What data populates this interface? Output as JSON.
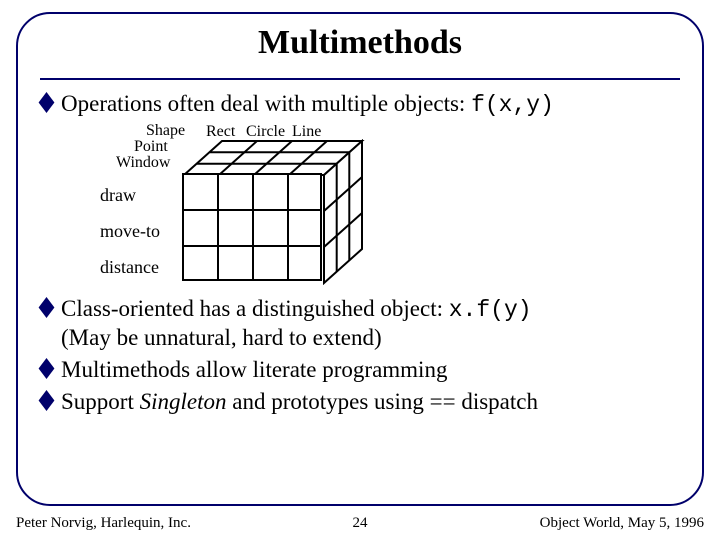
{
  "title": "Multimethods",
  "bullets": {
    "b1_a": "Operations often deal with multiple objects: ",
    "b1_code": "f(x,y)",
    "b2_a": "Class-oriented has a distinguished object: ",
    "b2_code": "x.f(y)",
    "b2_b": "(May be unnatural, hard to extend)",
    "b3": "Multimethods allow literate programming",
    "b4_a": "Support ",
    "b4_i": "Singleton",
    "b4_b": " and prototypes using == dispatch"
  },
  "grid": {
    "top_labels": {
      "shape": "Shape",
      "point": "Point",
      "window": "Window"
    },
    "col_labels": {
      "rect": "Rect",
      "circle": "Circle",
      "line": "Line"
    },
    "row_labels": {
      "draw": "draw",
      "moveto": "move-to",
      "distance": "distance"
    }
  },
  "footer": {
    "left": "Peter Norvig, Harlequin, Inc.",
    "center": "24",
    "right": "Object World, May 5, 1996"
  }
}
